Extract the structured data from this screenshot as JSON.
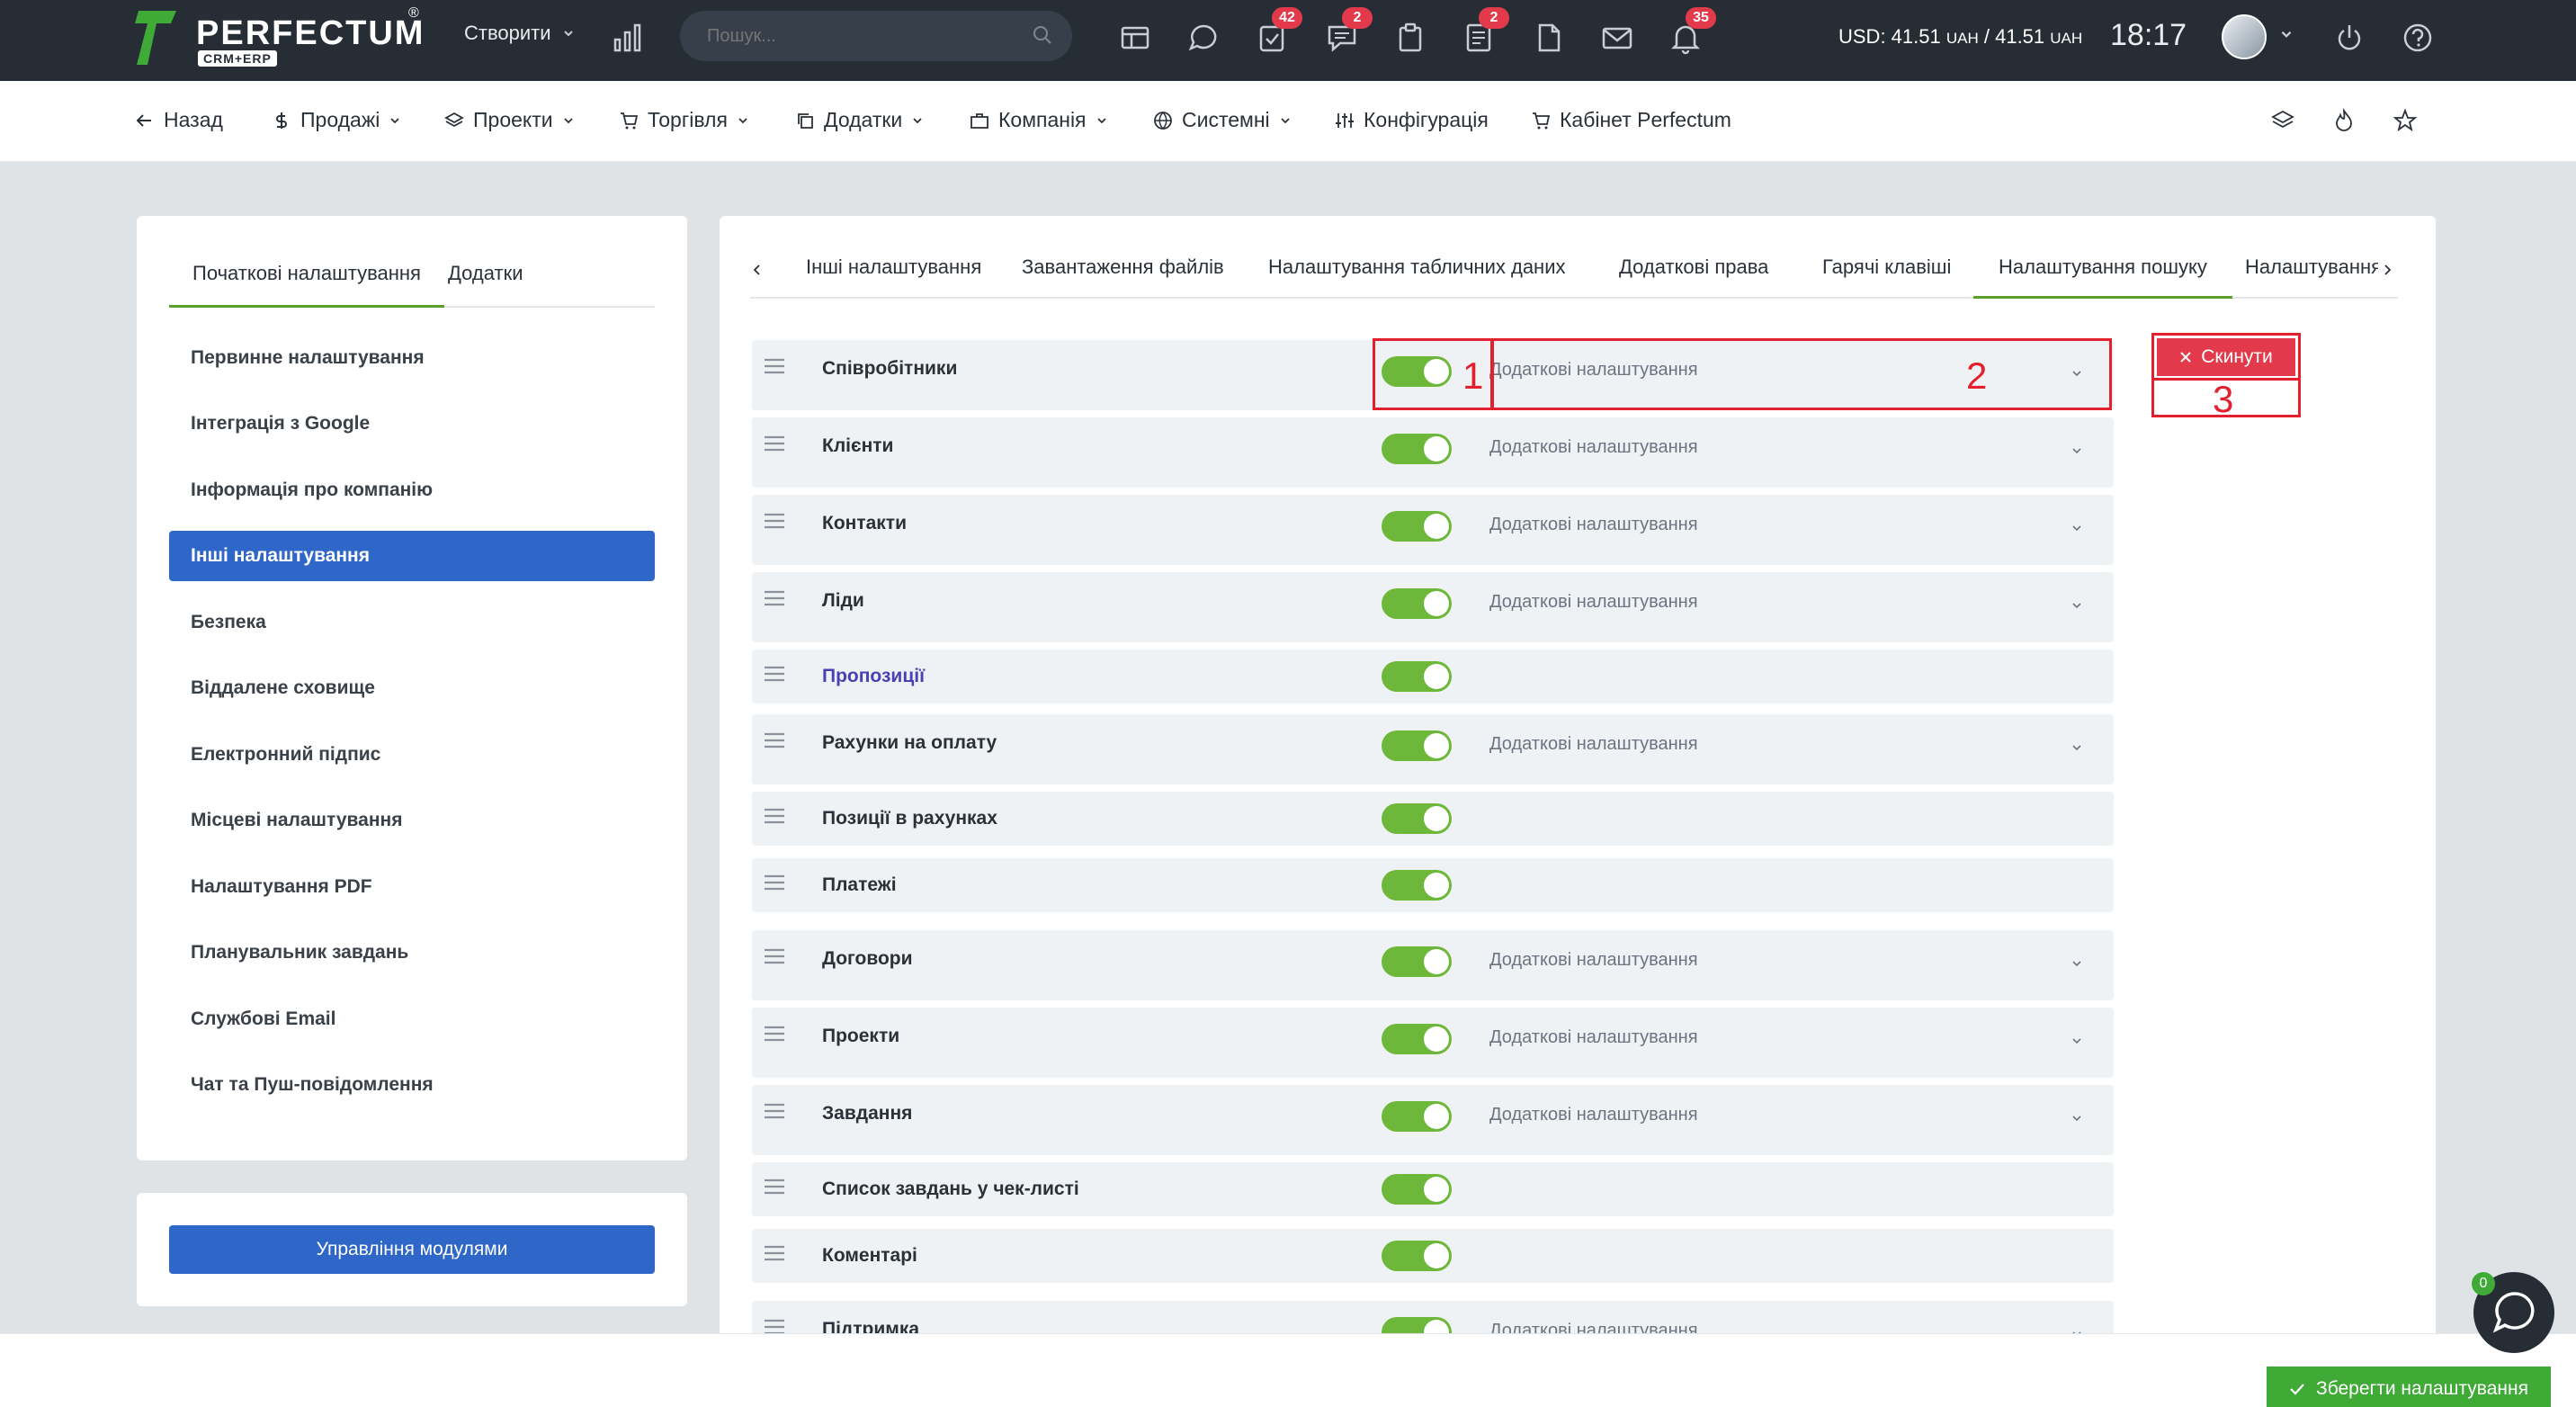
{
  "topbar": {
    "brand": "PERFECTUM",
    "brand_sub": "CRM+ERP",
    "brand_reg": "®",
    "create_label": "Створити",
    "search_placeholder": "Пошук...",
    "badges": {
      "tasks": "42",
      "chat": "2",
      "notes": "2",
      "notifications": "35"
    },
    "currency_label": "USD: 41.51",
    "currency_unit1": "UAH",
    "currency_sep": " / 41.51 ",
    "currency_unit2": "UAH",
    "time": "18:17"
  },
  "nav": {
    "back": "Назад",
    "sales": "Продажі",
    "projects": "Проекти",
    "trade": "Торгівля",
    "addons": "Додатки",
    "company": "Компанія",
    "system": "Системні",
    "config": "Конфігурація",
    "cabinet": "Кабінет Perfectum"
  },
  "left": {
    "tabs": [
      "Початкові налаштування",
      "Додатки"
    ],
    "items": [
      "Первинне налаштування",
      "Інтеграція з Google",
      "Інформація про компанію",
      "Інші налаштування",
      "Безпека",
      "Віддалене сховище",
      "Електронний підпис",
      "Місцеві налаштування",
      "Налаштування PDF",
      "Планувальник завдань",
      "Службові Email",
      "Чат та Пуш-повідомлення"
    ],
    "active_item": "Інші налаштування",
    "modules_button": "Управління модулями"
  },
  "settings": {
    "tabs": [
      "Інші налаштування",
      "Завантаження файлів",
      "Налаштування табличних даних",
      "Додаткові права",
      "Гарячі клавіші",
      "Налаштування пошуку",
      "Налаштування"
    ],
    "active_tab": "Налаштування пошуку",
    "extra_label": "Додаткові налаштування",
    "rows": [
      {
        "label": "Співробітники",
        "enabled": true,
        "extra": true
      },
      {
        "label": "Клієнти",
        "enabled": true,
        "extra": true
      },
      {
        "label": "Контакти",
        "enabled": true,
        "extra": true
      },
      {
        "label": "Ліди",
        "enabled": true,
        "extra": true
      },
      {
        "label": "Пропозиції",
        "enabled": true,
        "extra": false
      },
      {
        "label": "Рахунки на оплату",
        "enabled": true,
        "extra": true
      },
      {
        "label": "Позиції в рахунках",
        "enabled": true,
        "extra": false
      },
      {
        "label": "Платежі",
        "enabled": true,
        "extra": false
      },
      {
        "label": "Договори",
        "enabled": true,
        "extra": true
      },
      {
        "label": "Проекти",
        "enabled": true,
        "extra": true
      },
      {
        "label": "Завдання",
        "enabled": true,
        "extra": true
      },
      {
        "label": "Список завдань у чек-листі",
        "enabled": true,
        "extra": false
      },
      {
        "label": "Коментарі",
        "enabled": true,
        "extra": false
      },
      {
        "label": "Підтримка",
        "enabled": true,
        "extra": true
      }
    ],
    "reset_button": "Скинути",
    "annotations": [
      "1",
      "2",
      "3"
    ]
  },
  "footer": {
    "save_button": "Зберегти налаштування",
    "chat_badge": "0"
  },
  "colors": {
    "topbar": "#262d35",
    "accent_blue": "#2e67c7",
    "toggle_green": "#6db83a",
    "danger": "#e23a4b",
    "save_green": "#3faa35",
    "annotation_red": "#e3202e"
  }
}
